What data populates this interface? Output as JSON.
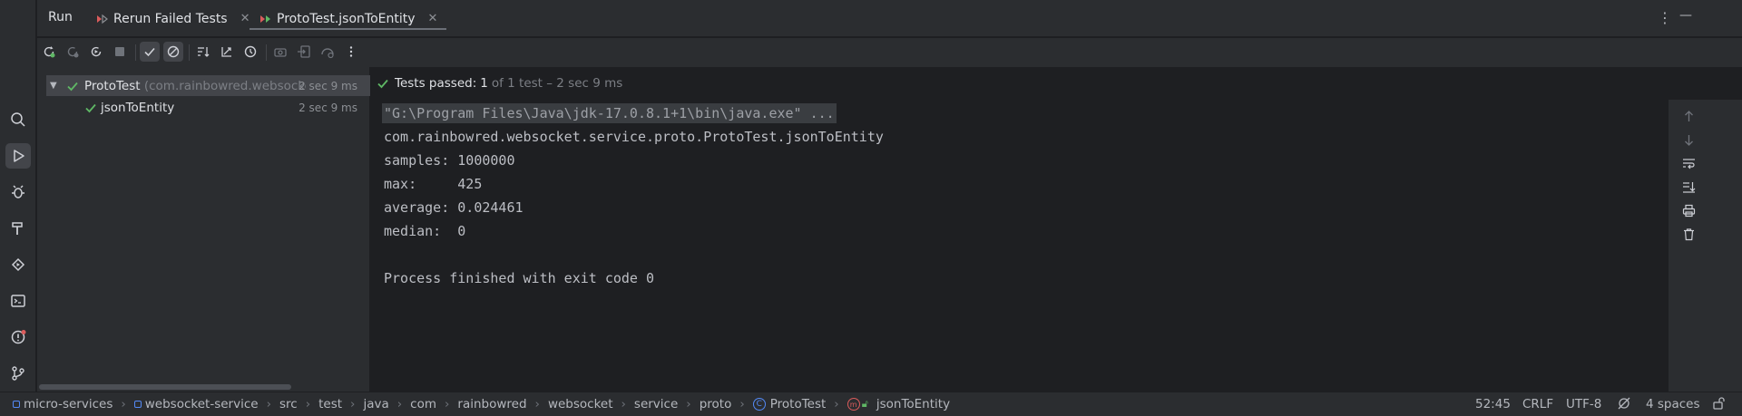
{
  "window": {
    "run_title": "Run",
    "tabs": [
      {
        "label": "Rerun Failed Tests",
        "icon": "rerun-failed-icon",
        "selected": false
      },
      {
        "label": "ProtoTest.jsonToEntity",
        "icon": "test-config-icon",
        "selected": true
      }
    ],
    "close_glyph": "✕",
    "more_glyph": "⋮",
    "minimize_glyph": "—"
  },
  "left_strip": [
    {
      "icon": "search-icon",
      "active": false
    },
    {
      "icon": "run-icon",
      "active": true
    },
    {
      "icon": "debug-icon",
      "active": false
    },
    {
      "icon": "build-icon",
      "active": false
    },
    {
      "icon": "services-icon",
      "active": false
    },
    {
      "icon": "terminal-icon",
      "active": false
    },
    {
      "icon": "problems-icon",
      "active": false
    },
    {
      "icon": "git-icon",
      "active": false
    }
  ],
  "toolbar": [
    {
      "icon": "rerun-icon"
    },
    {
      "icon": "rerun-failed-icon"
    },
    {
      "icon": "toggle-auto-test-icon"
    },
    {
      "icon": "stop-icon"
    },
    {
      "icon": "show-passed-icon",
      "on": true
    },
    {
      "icon": "show-ignored-icon",
      "on": true
    },
    {
      "icon": "sort-alpha-icon"
    },
    {
      "icon": "sort-duration-icon"
    },
    {
      "icon": "history-icon"
    },
    {
      "icon": "camera-icon"
    },
    {
      "icon": "import-tests-icon"
    },
    {
      "icon": "coverage-icon"
    },
    {
      "icon": "more-icon"
    }
  ],
  "tree": {
    "root": {
      "name": "ProtoTest",
      "package": "(com.rainbowred.websocke",
      "time": "2 sec 9 ms"
    },
    "child": {
      "name": "jsonToEntity",
      "time": "2 sec 9 ms"
    }
  },
  "status": {
    "label": "Tests passed:",
    "count": "1",
    "detail": "of 1 test – 2 sec 9 ms"
  },
  "console": {
    "lines": [
      "\"G:\\Program Files\\Java\\jdk-17.0.8.1+1\\bin\\java.exe\" ...",
      "com.rainbowred.websocket.service.proto.ProtoTest.jsonToEntity",
      "samples: 1000000",
      "max:     425",
      "average: 0.024461",
      "median:  0",
      "",
      "Process finished with exit code 0"
    ]
  },
  "statusbar": {
    "breadcrumbs": [
      "micro-services",
      "websocket-service",
      "src",
      "test",
      "java",
      "com",
      "rainbowred",
      "websocket",
      "service",
      "proto",
      "ProtoTest",
      "jsonToEntity"
    ],
    "separator": "›",
    "class_icon_letter": "C",
    "position": "52:45",
    "line_sep": "CRLF",
    "encoding": "UTF-8",
    "indent": "4 spaces"
  },
  "colors": {
    "pass_green": "#5fb865",
    "accent_blue": "#548af7",
    "error_red": "#db5c5c"
  }
}
